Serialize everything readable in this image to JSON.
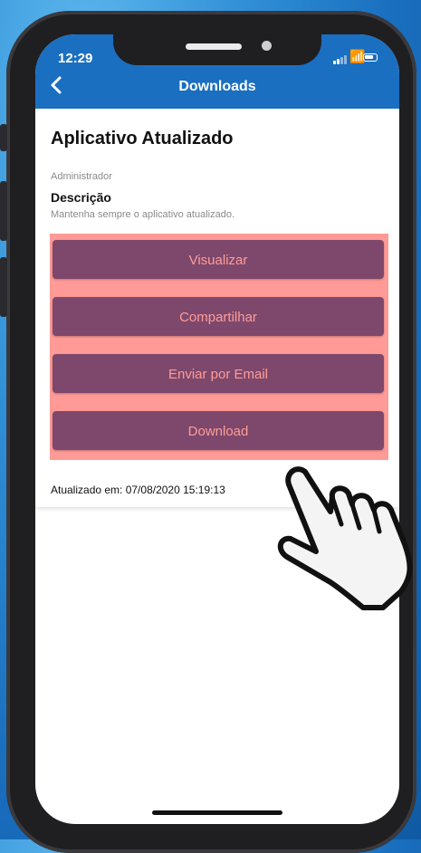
{
  "status_bar": {
    "time": "12:29"
  },
  "header": {
    "title": "Downloads",
    "back_icon": "chevron-left-icon"
  },
  "content": {
    "title": "Aplicativo Atualizado",
    "author": "Administrador",
    "description_label": "Descrição",
    "description": "Mantenha sempre o aplicativo atualizado.",
    "buttons": [
      {
        "label": "Visualizar"
      },
      {
        "label": "Compartilhar"
      },
      {
        "label": "Enviar por Email"
      },
      {
        "label": "Download"
      }
    ],
    "updated": "Atualizado em: 07/08/2020 15:19:13"
  },
  "colors": {
    "header": "#1b6fc0",
    "highlight": "#ff9a96",
    "button_bg": "#7e486c",
    "button_text": "#ff9c97"
  },
  "overlay": {
    "icon": "pointing-hand-icon"
  }
}
